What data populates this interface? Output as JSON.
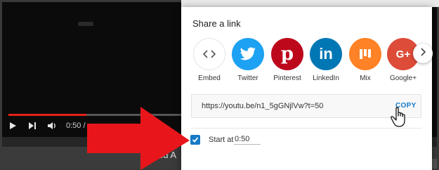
{
  "player": {
    "time_display": "0:50 / ",
    "bottom_text": "ed A",
    "progress_fraction": 0.45
  },
  "share": {
    "title": "Share a link",
    "targets": [
      {
        "label": "Embed",
        "icon": "embed-code-icon",
        "color": "#f1f1f1"
      },
      {
        "label": "Twitter",
        "icon": "twitter-bird-icon",
        "color": "#1da1f2"
      },
      {
        "label": "Pinterest",
        "icon": "pinterest-p-icon",
        "color": "#bd081c"
      },
      {
        "label": "LinkedIn",
        "icon": "linkedin-in-icon",
        "color": "#0077b5"
      },
      {
        "label": "Mix",
        "icon": "mix-logo-icon",
        "color": "#ff8226"
      },
      {
        "label": "Google+",
        "icon": "google-plus-icon",
        "color": "#dd4b39"
      }
    ],
    "url": "https://youtu.be/n1_5gGNjlVw?t=50",
    "copy_label": "COPY",
    "start_at_label": "Start at",
    "start_at_value": "0:50",
    "start_at_checked": true,
    "accent_color": "#167ac6"
  },
  "overlay": {
    "arrow_color": "#e8161b"
  }
}
